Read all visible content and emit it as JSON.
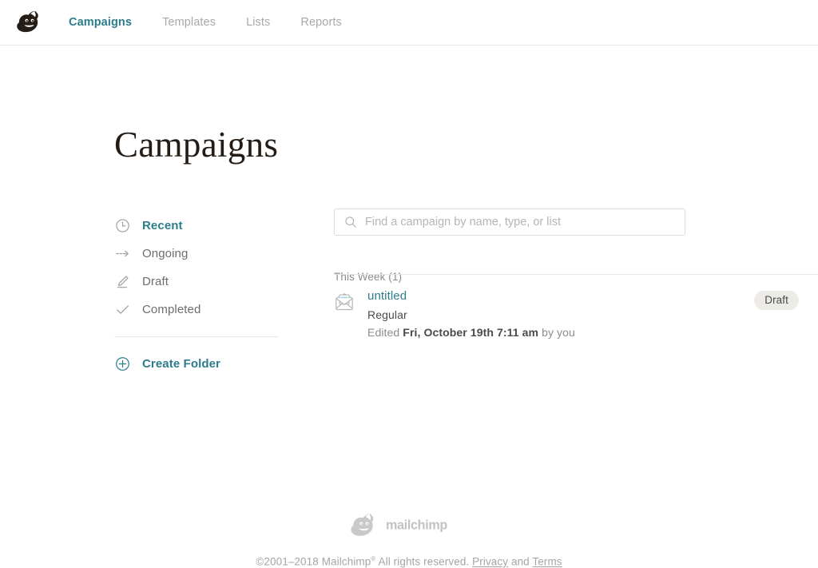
{
  "header": {
    "logo_name": "mailchimp-freddie-logo",
    "nav": [
      {
        "label": "Campaigns",
        "active": true
      },
      {
        "label": "Templates",
        "active": false
      },
      {
        "label": "Lists",
        "active": false
      },
      {
        "label": "Reports",
        "active": false
      }
    ]
  },
  "page": {
    "title": "Campaigns"
  },
  "sidebar": {
    "items": [
      {
        "label": "Recent",
        "icon": "clock-icon",
        "active": true
      },
      {
        "label": "Ongoing",
        "icon": "dashed-arrow-icon",
        "active": false
      },
      {
        "label": "Draft",
        "icon": "pencil-icon",
        "active": false
      },
      {
        "label": "Completed",
        "icon": "check-icon",
        "active": false
      }
    ],
    "create_folder": {
      "label": "Create Folder",
      "icon": "plus-circle-icon"
    }
  },
  "search": {
    "placeholder": "Find a campaign by name, type, or list",
    "value": "",
    "icon": "search-icon"
  },
  "list": {
    "section_label": "This Week (1)",
    "campaigns": [
      {
        "name": "untitled",
        "type": "Regular",
        "edited_prefix": "Edited ",
        "edited_date": "Fri, October 19th 7:11 am",
        "edited_suffix": " by you",
        "status": "Draft",
        "icon": "email-envelope-icon"
      }
    ]
  },
  "footer": {
    "wordmark": "mailchimp",
    "copyright_prefix": "©2001–2018 Mailchimp",
    "registered_mark": "®",
    "copyright_middle": " All rights reserved. ",
    "privacy_label": "Privacy",
    "and_label": " and ",
    "terms_label": "Terms"
  },
  "colors": {
    "accent_teal": "#2c7c8c",
    "muted_grey": "#8d8d8d",
    "badge_bg": "#edebe6",
    "border": "#e6e6e6"
  }
}
